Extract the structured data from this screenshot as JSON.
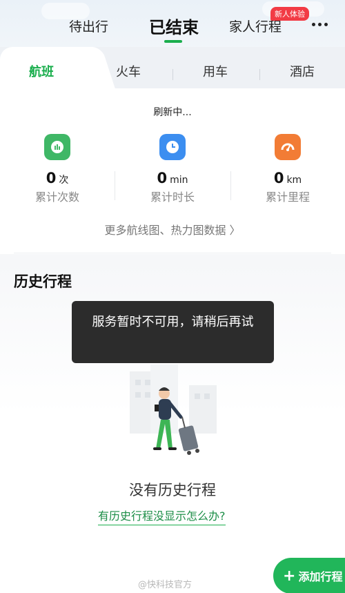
{
  "top_tabs": {
    "upcoming": "待出行",
    "finished": "已结束",
    "family": "家人行程",
    "family_badge": "新人体验"
  },
  "sub_tabs": [
    "航班",
    "火车",
    "用车",
    "酒店"
  ],
  "stats": {
    "refresh_text": "刷新中...",
    "items": [
      {
        "value": "0",
        "unit": "次",
        "label": "累计次数",
        "icon": "chart-icon",
        "color": "#3fb766"
      },
      {
        "value": "0",
        "unit": "min",
        "label": "累计时长",
        "icon": "clock-icon",
        "color": "#3c8ef0"
      },
      {
        "value": "0",
        "unit": "km",
        "label": "累计里程",
        "icon": "gauge-icon",
        "color": "#f27c35"
      }
    ],
    "more_link": "更多航线图、热力图数据 〉"
  },
  "history": {
    "title": "历史行程",
    "toast": "服务暂时不可用，请稍后再试",
    "empty_title": "没有历史行程",
    "empty_help": "有历史行程没显示怎么办?"
  },
  "add_button": "添加行程",
  "watermark": "@快科技官方",
  "colors": {
    "accent": "#1aae4d",
    "badge": "#f23b45"
  }
}
